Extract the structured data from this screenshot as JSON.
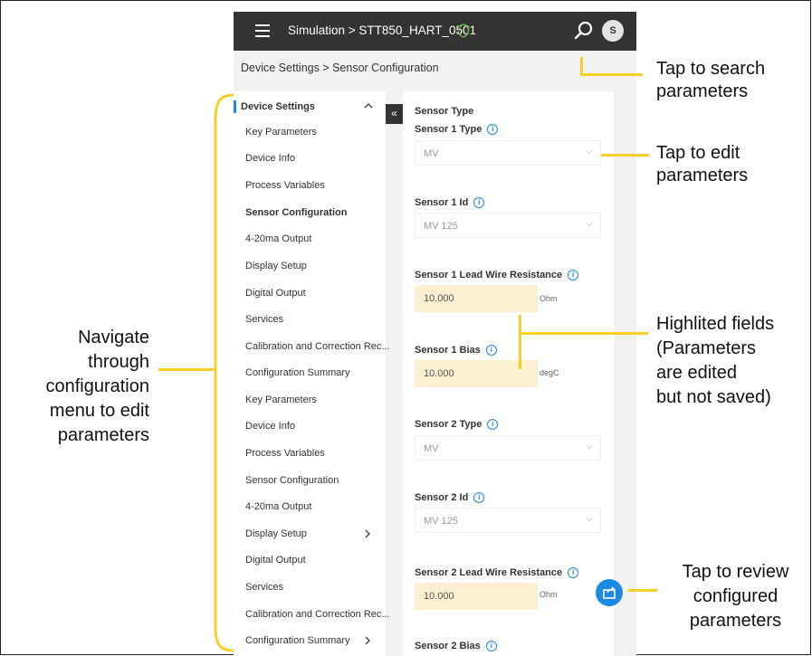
{
  "app": {
    "title": "Simulation > STT850_HART_0501",
    "avatar": "S",
    "breadcrumb": "Device Settings > Sensor Configuration"
  },
  "nav": {
    "header": "Device Settings",
    "items": [
      "Key Parameters",
      "Device Info",
      "Process Variables",
      "Sensor Configuration",
      "4-20ma Output",
      "Display Setup",
      "Digital Output",
      "Services",
      "Calibration and Correction Rec...",
      "Configuration Summary",
      "Key Parameters",
      "Device Info",
      "Process Variables",
      "Sensor Configuration",
      "4-20ma Output",
      "Display Setup",
      "Digital Output",
      "Services",
      "Calibration and Correction Rec...",
      "Configuration Summary"
    ]
  },
  "content": {
    "section": "Sensor Type",
    "fields": {
      "s1type_label": "Sensor 1 Type",
      "s1type_value": "MV",
      "s1id_label": "Sensor 1 Id",
      "s1id_value": "MV 125",
      "s1lead_label": "Sensor 1 Lead Wire Resistance",
      "s1lead_value": "10.000",
      "s1lead_unit": "Ohm",
      "s1bias_label": "Sensor 1 Bias",
      "s1bias_value": "10.000",
      "s1bias_unit": "degC",
      "s2type_label": "Sensor 2 Type",
      "s2type_value": "MV",
      "s2id_label": "Sensor 2 Id",
      "s2id_value": "MV 125",
      "s2lead_label": "Sensor 2 Lead Wire Resistance",
      "s2lead_value": "10.000",
      "s2lead_unit": "Ohm",
      "s2bias_label": "Sensor 2 Bias"
    }
  },
  "annotations": {
    "search": [
      "Tap to search",
      "parameters"
    ],
    "edit": [
      "Tap to edit",
      "parameters"
    ],
    "highlighted": [
      "Highlited fields",
      "(Parameters",
      "are edited",
      "but not saved)"
    ],
    "navigate": [
      "Navigate",
      "through",
      "configuration",
      "menu to edit",
      "parameters"
    ],
    "review": [
      "Tap to review",
      "configured",
      "parameters"
    ]
  },
  "colors": {
    "accent": "#1c8ae0",
    "highlight": "#fdf0d0",
    "callout": "#f6cf28",
    "topbar": "#333333"
  }
}
